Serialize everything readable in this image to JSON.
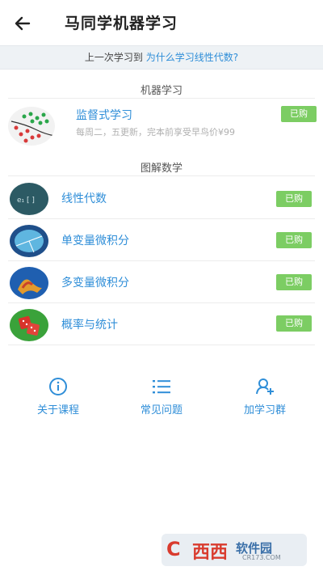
{
  "header": {
    "title": "马同学机器学习"
  },
  "last_study": {
    "prefix": "上一次学习到",
    "link": "为什么学习线性代数?"
  },
  "ml_section": {
    "label": "机器学习",
    "item": {
      "title": "监督式学习",
      "subtitle": "每周二，五更新，完本前享受早鸟价¥99",
      "badge": "已购"
    }
  },
  "math_section": {
    "label": "图解数学",
    "items": [
      {
        "title": "线性代数",
        "badge": "已购",
        "icon": "linear-algebra-thumbnail"
      },
      {
        "title": "单变量微积分",
        "badge": "已购",
        "icon": "single-variable-calculus-thumbnail"
      },
      {
        "title": "多变量微积分",
        "badge": "已购",
        "icon": "multivariable-calculus-thumbnail"
      },
      {
        "title": "概率与统计",
        "badge": "已购",
        "icon": "probability-dice-thumbnail"
      }
    ]
  },
  "bottom_nav": [
    {
      "label": "关于课程",
      "icon": "info-icon"
    },
    {
      "label": "常见问题",
      "icon": "list-icon"
    },
    {
      "label": "加学习群",
      "icon": "add-group-icon"
    }
  ],
  "watermark": {
    "c": "C",
    "brand": "西西",
    "rest": "软件园",
    "site": "CR173.COM"
  },
  "colors": {
    "accent": "#2f8ed8",
    "badge": "#7ccd63"
  }
}
